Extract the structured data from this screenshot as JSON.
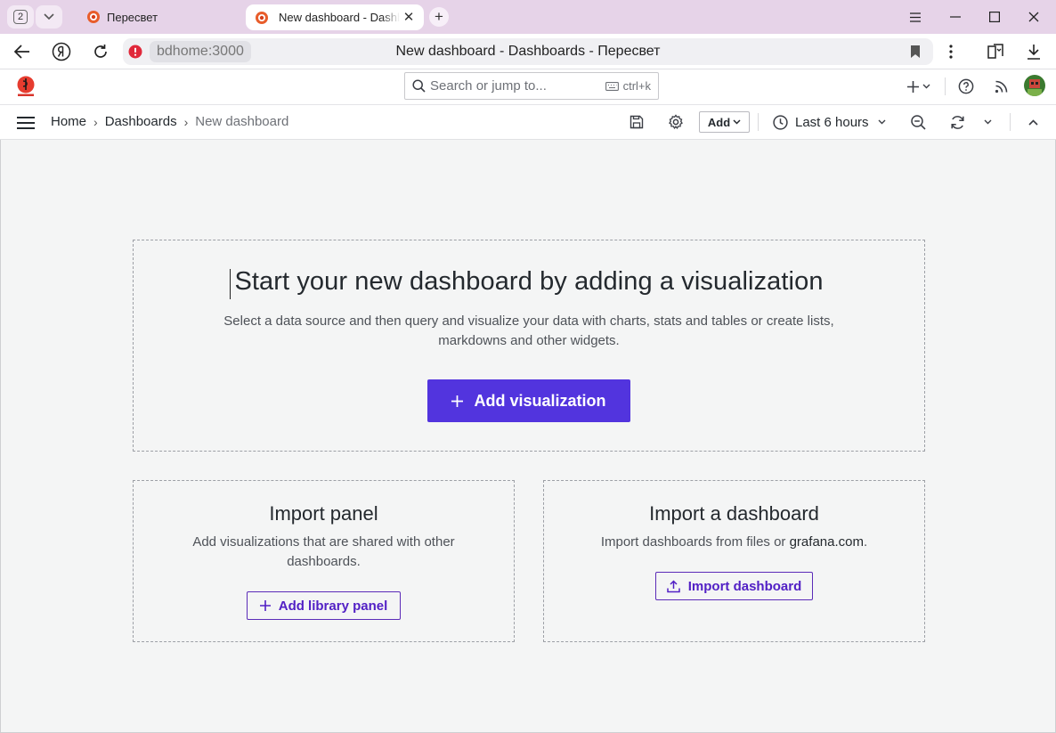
{
  "browser": {
    "tab_count": "2",
    "tabs": [
      {
        "title": "Пересвет",
        "active": false
      },
      {
        "title": "New dashboard - Dashboards - Пересвет",
        "active": true
      }
    ],
    "address": {
      "host": "bdhome:3000",
      "title": "New dashboard - Dashboards - Пересвет"
    }
  },
  "topnav": {
    "search_placeholder": "Search or jump to...",
    "search_shortcut": "ctrl+k",
    "add_label": "+"
  },
  "toolbar": {
    "breadcrumbs": [
      "Home",
      "Dashboards",
      "New dashboard"
    ],
    "breadcrumb_separator": "›",
    "add_button": "Add",
    "time_range": "Last 6 hours"
  },
  "empty_state": {
    "title": "Start your new dashboard by adding a visualization",
    "description": "Select a data source and then query and visualize your data with charts, stats and tables or create lists, markdowns and other widgets.",
    "button": "Add visualization"
  },
  "import_panel": {
    "title": "Import panel",
    "description": "Add visualizations that are shared with other dashboards.",
    "button": "Add library panel"
  },
  "import_dashboard": {
    "title": "Import a dashboard",
    "description_prefix": "Import dashboards from files or ",
    "description_link": "grafana.com",
    "description_suffix": ".",
    "button": "Import dashboard"
  },
  "colors": {
    "primary": "#5234de",
    "tabstrip": "#e6d3e8",
    "canvas": "#f4f5f5"
  }
}
